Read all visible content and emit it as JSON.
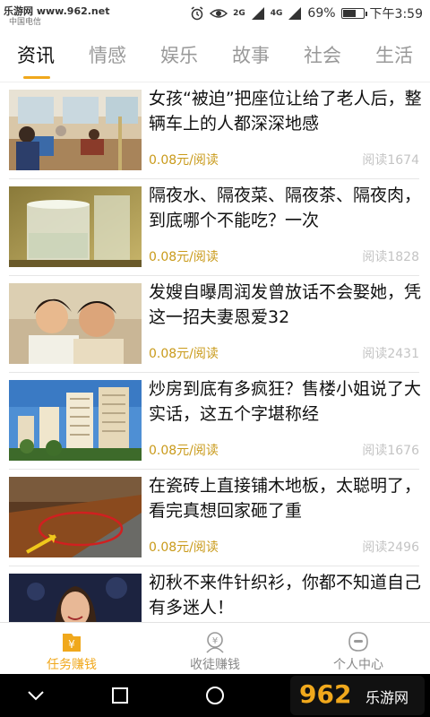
{
  "status_bar": {
    "site_label": "乐游网 www.962.net",
    "carrier": "中国电信",
    "network_2g": "2G",
    "network_4g": "4G",
    "battery_text": "69%",
    "battery_level": 0.69,
    "time": "下午3:59"
  },
  "tabs": [
    {
      "label": "资讯",
      "active": true
    },
    {
      "label": "情感",
      "active": false
    },
    {
      "label": "娱乐",
      "active": false
    },
    {
      "label": "故事",
      "active": false
    },
    {
      "label": "社会",
      "active": false
    },
    {
      "label": "生活",
      "active": false
    }
  ],
  "articles": [
    {
      "title": "女孩“被迫”把座位让给了老人后，整辆车上的人都深深地感",
      "price": "0.08元/阅读",
      "reads": "阅读1674",
      "image": "bus-interior"
    },
    {
      "title": "隔夜水、隔夜菜、隔夜茶、隔夜肉，到底哪个不能吃？一次",
      "price": "0.08元/阅读",
      "reads": "阅读1828",
      "image": "glass-of-water"
    },
    {
      "title": "发嫂自曝周润发曾放话不会娶她，凭这一招夫妻恩爱32",
      "price": "0.08元/阅读",
      "reads": "阅读2431",
      "image": "couple-photo"
    },
    {
      "title": "炒房到底有多疯狂？售楼小姐说了大实话，这五个字堪称经",
      "price": "0.08元/阅读",
      "reads": "阅读1676",
      "image": "apartment-towers"
    },
    {
      "title": "在瓷砖上直接铺木地板，太聪明了，看完真想回家砸了重",
      "price": "0.08元/阅读",
      "reads": "阅读2496",
      "image": "wood-floor-on-tile"
    },
    {
      "title": "初秋不来件针织衫，你都不知道自己有多迷人！",
      "price": "",
      "reads": "",
      "image": "woman-portrait"
    }
  ],
  "bottom_nav": [
    {
      "label": "任务赚钱",
      "icon": "task-money-icon",
      "active": true
    },
    {
      "label": "收徒赚钱",
      "icon": "apprentice-money-icon",
      "active": false
    },
    {
      "label": "个人中心",
      "icon": "profile-center-icon",
      "active": false
    }
  ],
  "watermark": {
    "text_top": "962",
    "text_bottom": "乐游网"
  },
  "colors": {
    "accent": "#f0a81c",
    "price": "#c99a1a",
    "muted": "#c4c4c4"
  }
}
